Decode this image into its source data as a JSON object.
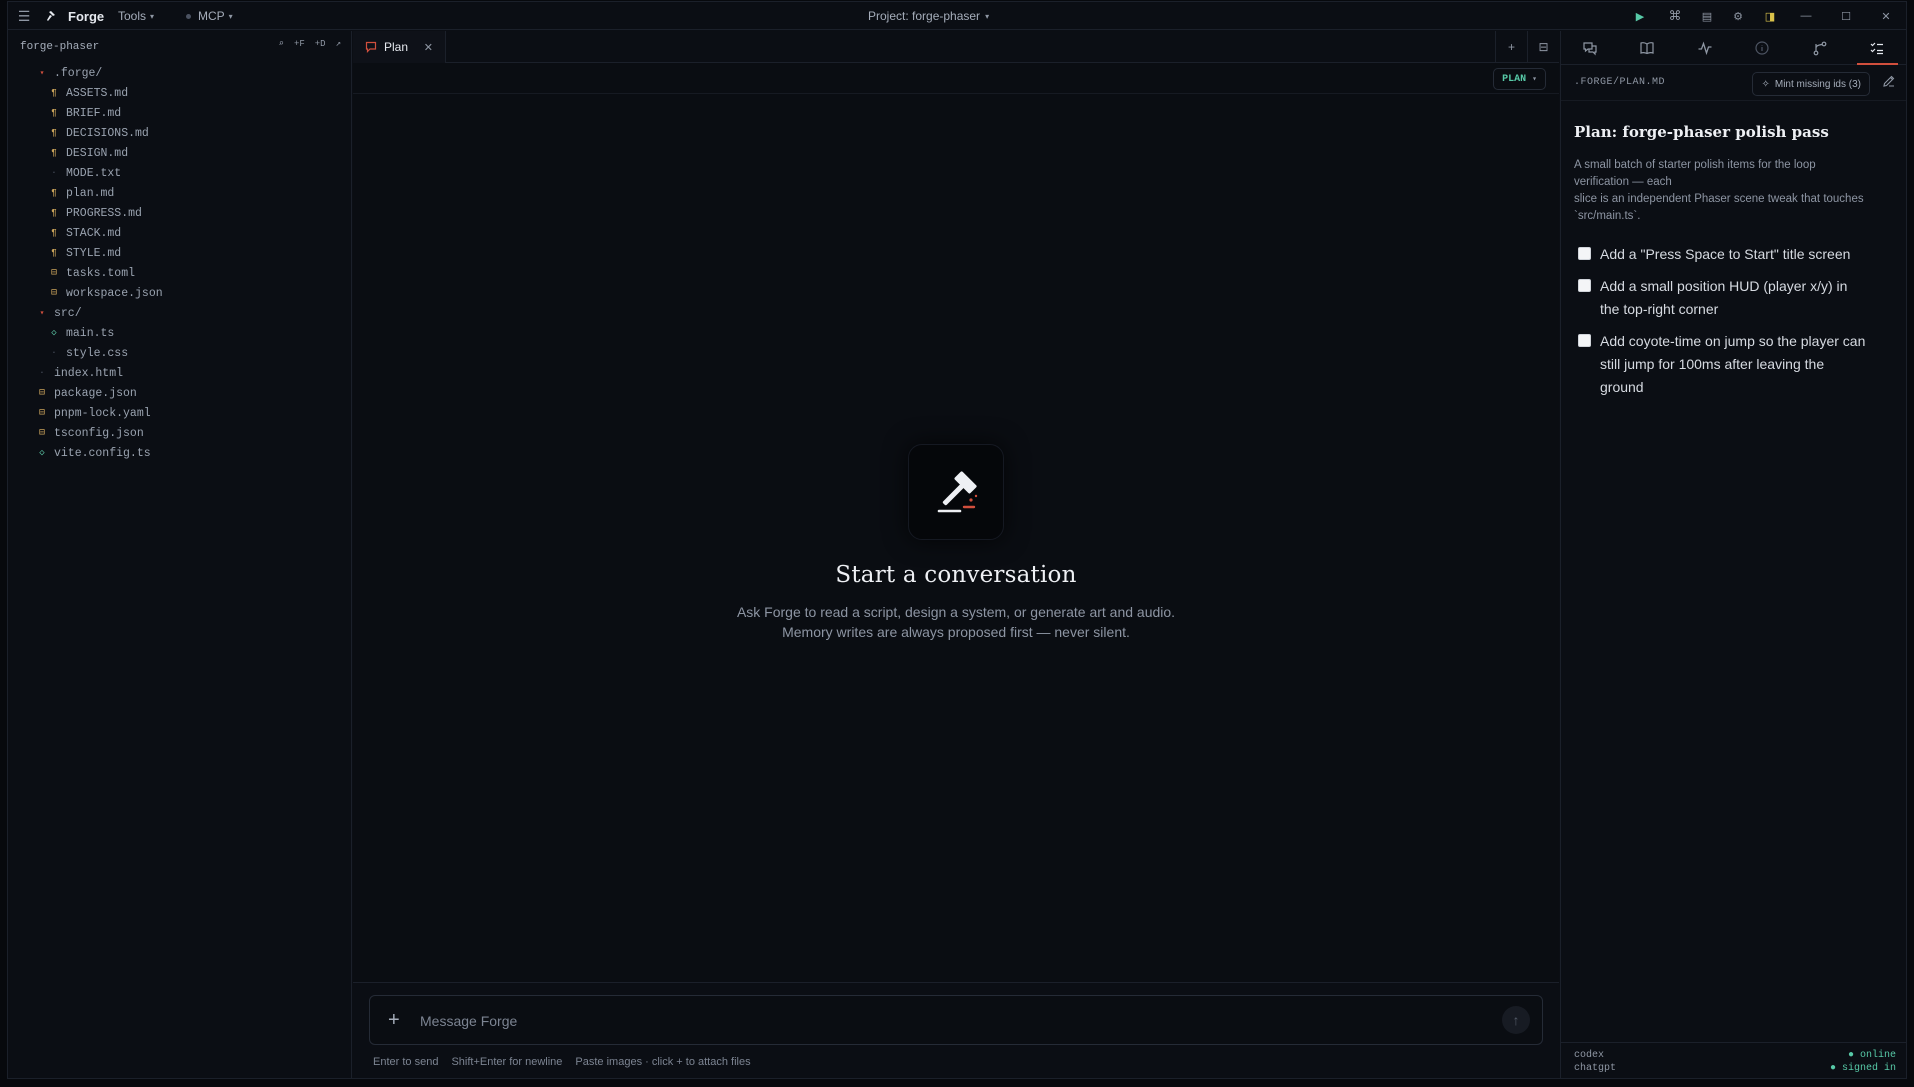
{
  "titlebar": {
    "app_name": "Forge",
    "menu_tools": "Tools",
    "menu_mcp": "MCP",
    "project_title": "Project: forge-phaser",
    "accent_color": "#d14f3d",
    "success_color": "#57c9a7"
  },
  "sidebar": {
    "title": "forge-phaser",
    "actions": [
      "⌕",
      "+F",
      "+D",
      "↗"
    ],
    "tree": [
      {
        "name": ".forge/",
        "type": "folder",
        "depth": 0
      },
      {
        "name": "ASSETS.md",
        "type": "md",
        "depth": 1
      },
      {
        "name": "BRIEF.md",
        "type": "md",
        "depth": 1
      },
      {
        "name": "DECISIONS.md",
        "type": "md",
        "depth": 1
      },
      {
        "name": "DESIGN.md",
        "type": "md",
        "depth": 1
      },
      {
        "name": "MODE.txt",
        "type": "txt",
        "depth": 1
      },
      {
        "name": "plan.md",
        "type": "md",
        "depth": 1
      },
      {
        "name": "PROGRESS.md",
        "type": "md",
        "depth": 1
      },
      {
        "name": "STACK.md",
        "type": "md",
        "depth": 1
      },
      {
        "name": "STYLE.md",
        "type": "md",
        "depth": 1
      },
      {
        "name": "tasks.toml",
        "type": "data",
        "depth": 1
      },
      {
        "name": "workspace.json",
        "type": "data",
        "depth": 1
      },
      {
        "name": "src/",
        "type": "folder",
        "depth": 0
      },
      {
        "name": "main.ts",
        "type": "ts",
        "depth": 1
      },
      {
        "name": "style.css",
        "type": "css",
        "depth": 1
      },
      {
        "name": "index.html",
        "type": "html",
        "depth": 0
      },
      {
        "name": "package.json",
        "type": "data",
        "depth": 0
      },
      {
        "name": "pnpm-lock.yaml",
        "type": "data",
        "depth": 0
      },
      {
        "name": "tsconfig.json",
        "type": "data",
        "depth": 0
      },
      {
        "name": "vite.config.ts",
        "type": "ts",
        "depth": 0
      }
    ]
  },
  "center": {
    "tab_label": "Plan",
    "mode_label": "PLAN",
    "empty_title": "Start a conversation",
    "empty_desc": "Ask Forge to read a script, design a system, or generate art and audio. Memory writes are always proposed first — never silent.",
    "composer": {
      "placeholder": "Message Forge",
      "hints": [
        "Enter to send",
        "Shift+Enter for newline",
        "Paste images · click + to attach files"
      ]
    }
  },
  "right": {
    "plan_path": ".FORGE/PLAN.MD",
    "mint_label": "Mint missing ids (3)",
    "plan_title": "Plan: forge-phaser polish pass",
    "plan_desc_lines": [
      "A small batch of starter polish items for the loop",
      "verification — each",
      "slice is an independent Phaser scene tweak that touches",
      "`src/main.ts`."
    ],
    "items": [
      {
        "text": "Add a \"Press Space to Start\" title screen",
        "checked": false
      },
      {
        "text": "Add a small position HUD (player x/y) in the top-right corner",
        "checked": false
      },
      {
        "text": "Add coyote-time on jump so the player can still jump for 100ms after leaving the ground",
        "checked": false
      }
    ],
    "footer": [
      {
        "provider": "codex",
        "status": "● online"
      },
      {
        "provider": "chatgpt",
        "status": "● signed in"
      }
    ]
  }
}
